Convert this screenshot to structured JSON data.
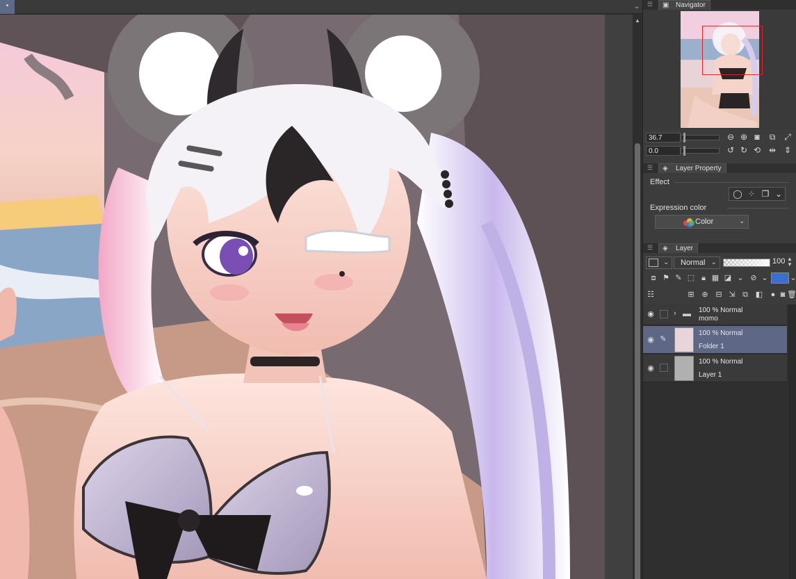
{
  "canvas": {
    "tab_glyph": "•",
    "menu_glyph": "⌄",
    "scroll_up": "▲",
    "scroll_down": "▼"
  },
  "navigator": {
    "title": "Navigator",
    "zoom_value": "36.7",
    "rotation_value": "0.0",
    "view_fraction": 0.5
  },
  "layer_property": {
    "title": "Layer Property",
    "effect_label": "Effect",
    "expression_label": "Expression color",
    "expression_value": "Color"
  },
  "layer_panel": {
    "title": "Layer",
    "blend_mode": "Normal",
    "opacity_value": "100",
    "layers": [
      {
        "mode": "100 % Normal",
        "name": "momo",
        "type": "folder",
        "selected": false
      },
      {
        "mode": "100 % Normal",
        "name": "Folder 1",
        "type": "raster",
        "selected": true
      },
      {
        "mode": "100 % Normal",
        "name": "Layer 1",
        "type": "raster",
        "selected": false
      }
    ]
  },
  "colors": {
    "accent": "#5e6886",
    "panel_bg": "#3c3c3c",
    "nav_frame": "#e0202a"
  }
}
